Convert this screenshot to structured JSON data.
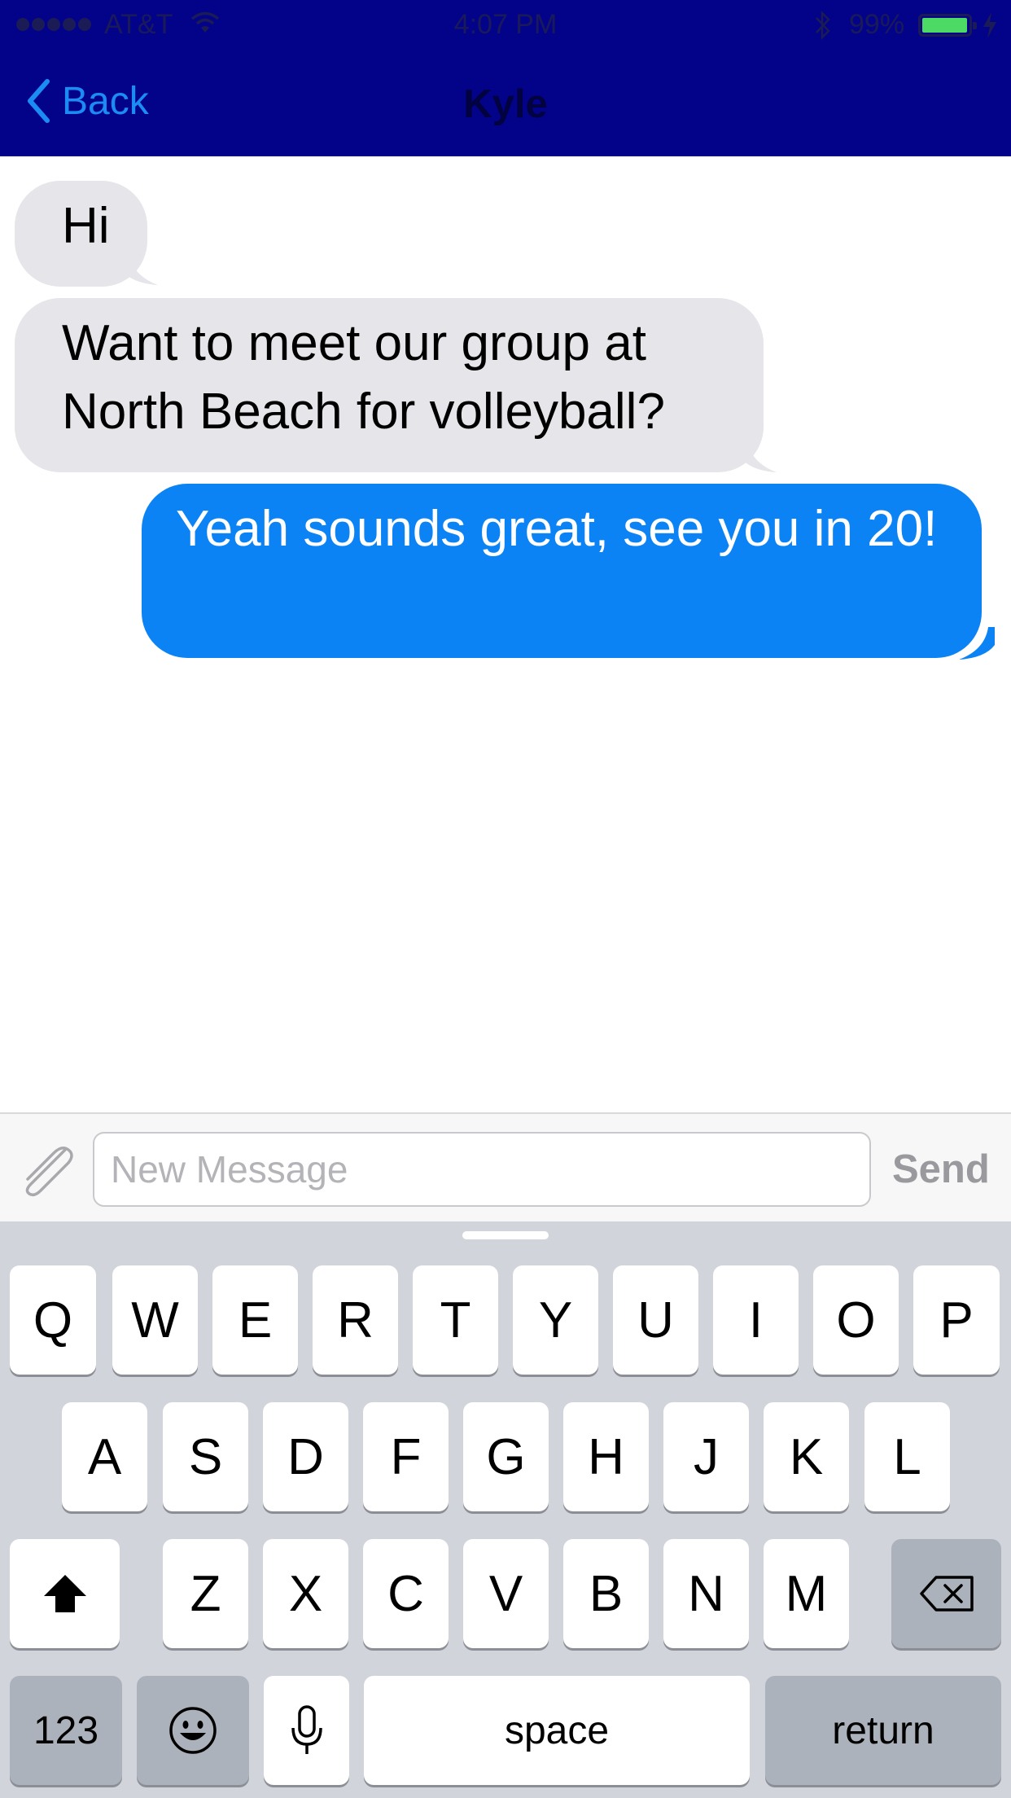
{
  "status_bar": {
    "carrier": "AT&T",
    "time": "4:07 PM",
    "battery": "99%",
    "battery_level": 0.99
  },
  "nav": {
    "back_label": "Back",
    "title": "Kyle"
  },
  "messages": [
    {
      "direction": "incoming",
      "text": "Hi"
    },
    {
      "direction": "incoming",
      "text": "Want to meet our group at North Beach for volleyball?"
    },
    {
      "direction": "outgoing",
      "text": "Yeah sounds great, see you in 20!"
    }
  ],
  "input_bar": {
    "placeholder": "New Message",
    "value": "",
    "send_label": "Send"
  },
  "keyboard": {
    "row1": [
      "Q",
      "W",
      "E",
      "R",
      "T",
      "Y",
      "U",
      "I",
      "O",
      "P"
    ],
    "row2": [
      "A",
      "S",
      "D",
      "F",
      "G",
      "H",
      "J",
      "K",
      "L"
    ],
    "row3": [
      "Z",
      "X",
      "C",
      "V",
      "B",
      "N",
      "M"
    ],
    "numbers_label": "123",
    "space_label": "space",
    "return_label": "return"
  },
  "colors": {
    "header_bg": "#03038a",
    "accent": "#1c8cf5",
    "outgoing_bubble": "#0c83f5",
    "incoming_bubble": "#e5e5ea",
    "keyboard_bg": "#d1d4da"
  },
  "icons": [
    "signal-dots-icon",
    "wifi-icon",
    "bluetooth-icon",
    "battery-icon",
    "charging-icon",
    "chevron-left-icon",
    "paperclip-icon",
    "shift-icon",
    "delete-icon",
    "emoji-icon",
    "microphone-icon"
  ]
}
